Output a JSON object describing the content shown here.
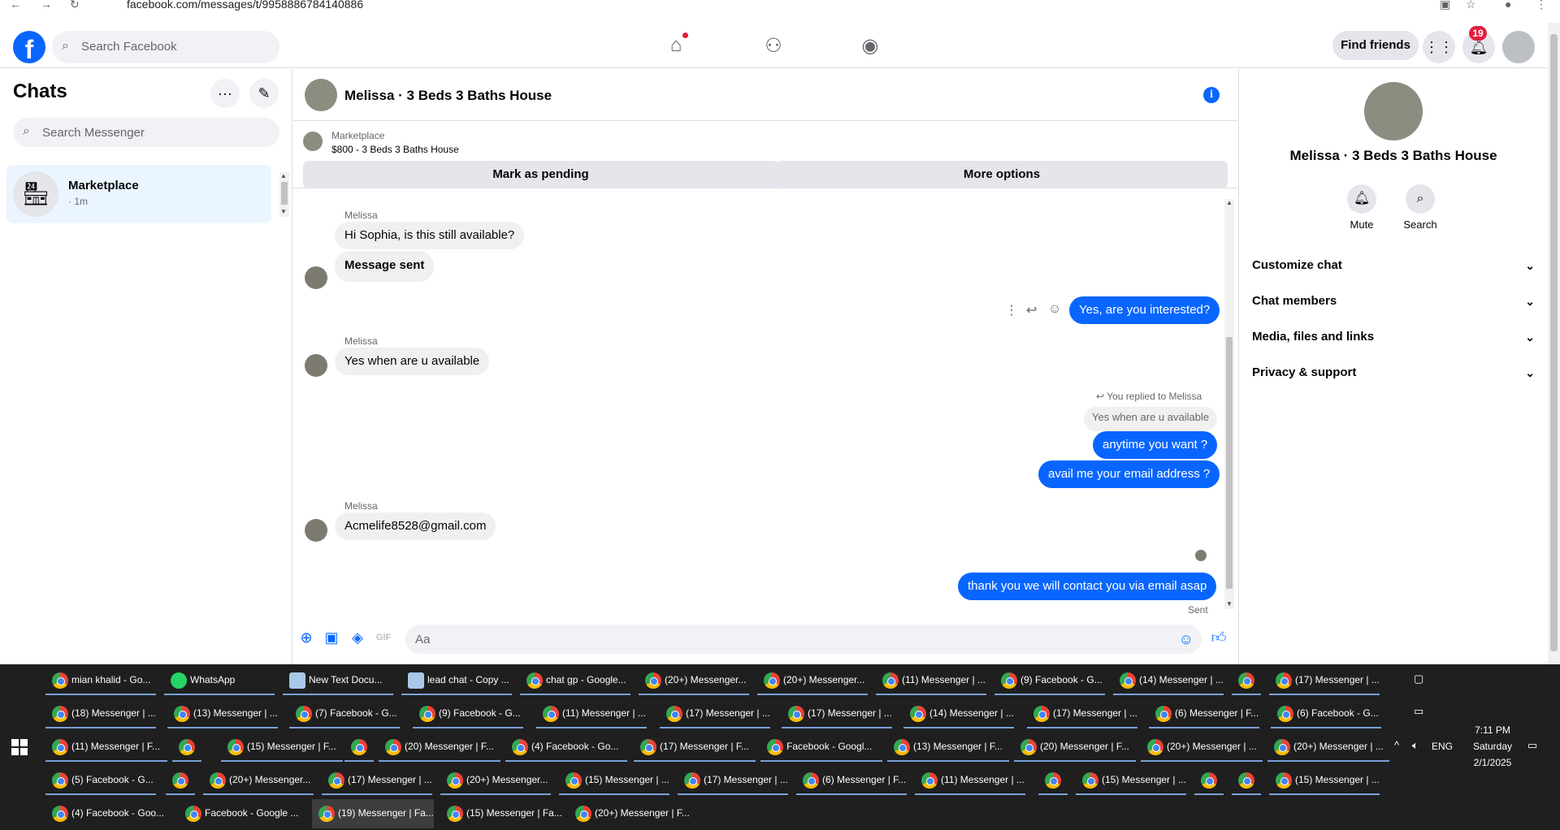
{
  "browser": {
    "url": "facebook.com/messages/t/9958886784140886"
  },
  "header": {
    "logo": "f",
    "search_placeholder": "Search Facebook",
    "find_friends": "Find friends",
    "notification_count": "19"
  },
  "sidebar": {
    "title": "Chats",
    "search_placeholder": "Search Messenger",
    "chats": [
      {
        "title": "Marketplace",
        "subtitle": "· 1m"
      }
    ]
  },
  "conversation": {
    "title": "Melissa · 3 Beds 3 Baths House",
    "marketplace_label": "Marketplace",
    "listing": "$800 - 3 Beds 3 Baths House",
    "mark_pending": "Mark as pending",
    "more_options": "More options",
    "messages": {
      "m1_sender": "Melissa",
      "m1_text": "Hi Sophia, is this still available?",
      "m2_text": "Message sent",
      "m3_text": "Yes, are you interested?",
      "m4_sender": "Melissa",
      "m4_text": "Yes when are u available",
      "replied_label": "You replied to Melissa",
      "reply_quote": "Yes when are u available",
      "m5_text": "anytime you want ?",
      "m6_text": "avail me your email address ?",
      "m7_sender": "Melissa",
      "m7_text": "Acmelife8528@gmail.com",
      "m8_text": "thank you we will contact you via email asap",
      "status": "Sent"
    },
    "composer_placeholder": "Aa"
  },
  "info_panel": {
    "name": "Melissa · 3 Beds 3 Baths House",
    "mute": "Mute",
    "search": "Search",
    "sections": [
      "Customize chat",
      "Chat members",
      "Media, files and links",
      "Privacy & support"
    ]
  },
  "taskbar": {
    "row1": [
      "mian khalid - Go...",
      "WhatsApp",
      "New Text Docu...",
      "lead chat - Copy ...",
      "chat gp - Google...",
      "(20+) Messenger...",
      "(20+) Messenger...",
      "(11) Messenger | ...",
      "(9) Facebook - G...",
      "(14) Messenger | ...",
      "",
      "(17) Messenger | ..."
    ],
    "row2": [
      "(18) Messenger | ...",
      "(13) Messenger | ...",
      "(7) Facebook - G...",
      "(9) Facebook - G...",
      "(11) Messenger | ...",
      "(17) Messenger | ...",
      "(17) Messenger | ...",
      "(14) Messenger | ...",
      "(17) Messenger | ...",
      "(6) Messenger | F...",
      "(6) Facebook - G..."
    ],
    "row3": [
      "(11) Messenger | F...",
      "",
      "(15) Messenger | F...",
      "",
      "(20) Messenger | F...",
      "(4) Facebook - Go...",
      "(17) Messenger | F...",
      "Facebook - Googl...",
      "(13) Messenger | F...",
      "(20) Messenger | F...",
      "(20+) Messenger | ...",
      "(20+) Messenger | ..."
    ],
    "row4": [
      "(5) Facebook - G...",
      "",
      "(20+) Messenger...",
      "(17) Messenger | ...",
      "(20+) Messenger...",
      "(15) Messenger | ...",
      "(17) Messenger | ...",
      "(6) Messenger | F...",
      "(11) Messenger | ...",
      "",
      "(15) Messenger | ...",
      "",
      "",
      "(15) Messenger | ..."
    ],
    "row5": [
      "(4) Facebook - Goo...",
      "Facebook - Google ...",
      "(19) Messenger | Fa...",
      "(15) Messenger | Fa...",
      "(20+) Messenger | F..."
    ],
    "tray_lang": "ENG",
    "time": "7:11 PM",
    "day": "Saturday",
    "date": "2/1/2025"
  },
  "icons": [
    "back-icon",
    "forward-icon",
    "reload-icon",
    "home-icon",
    "friends-icon",
    "groups-icon",
    "menu-grid-icon",
    "bell-icon",
    "more-icon",
    "compose-icon",
    "store-icon",
    "info-icon",
    "bell-icon",
    "search-icon",
    "chevron-down-icon",
    "plus-icon",
    "image-icon",
    "sticker-icon",
    "gif-icon",
    "emoji-icon",
    "like-icon",
    "reply-icon",
    "windows-icon"
  ],
  "colors": {
    "accent": "#0866ff",
    "selected_chat": "#ebf5ff",
    "taskbar": "#1f1f1f"
  }
}
